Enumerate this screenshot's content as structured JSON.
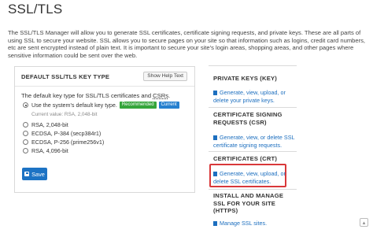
{
  "page": {
    "title": "SSL/TLS",
    "intro": "The SSL/TLS Manager will allow you to generate SSL certificates, certificate signing requests, and private keys. These are all parts of using SSL to secure your website. SSL allows you to secure pages on your site so that information such as logins, credit card numbers, etc are sent encrypted instead of plain text. It is important to secure your site's login areas, shopping areas, and other pages where sensitive information could be sent over the web."
  },
  "key_type_panel": {
    "title": "DEFAULT SSL/TLS KEY TYPE",
    "help_button": "Show Help Text",
    "default_text_before": "The default key type for SSL/TLS certificates and ",
    "default_text_csr": "CSRs",
    "default_text_after": ".",
    "options": [
      {
        "label": "Use the system's default key type.",
        "selected": true
      },
      {
        "label": "RSA, 2,048-bit",
        "selected": false
      },
      {
        "label": "ECDSA, P-384 (secp384r1)",
        "selected": false
      },
      {
        "label": "ECDSA, P-256 (prime256v1)",
        "selected": false
      },
      {
        "label": "RSA, 4,096-bit",
        "selected": false
      }
    ],
    "badge_recommended": "Recommended",
    "badge_current": "Current",
    "current_value": "Current value: RSA, 2,048-bit",
    "save_button": "Save"
  },
  "right_panel": {
    "private_keys_title": "PRIVATE KEYS (KEY)",
    "private_keys_link": "Generate, view, upload, or delete your private keys.",
    "csr_title": "CERTIFICATE SIGNING REQUESTS (CSR)",
    "csr_link": "Generate, view, or delete SSL certificate signing requests.",
    "crt_title": "CERTIFICATES (CRT)",
    "crt_link": "Generate, view, upload, or delete SSL certificates.",
    "install_title": "INSTALL AND MANAGE SSL FOR YOUR SITE (HTTPS)",
    "install_link": "Manage SSL sites."
  },
  "colors": {
    "link": "#1d6fbf",
    "save_button": "#1d73c4",
    "badge_recommended": "#35a53b",
    "badge_current": "#2680cf",
    "highlight_border": "#d9383a"
  }
}
